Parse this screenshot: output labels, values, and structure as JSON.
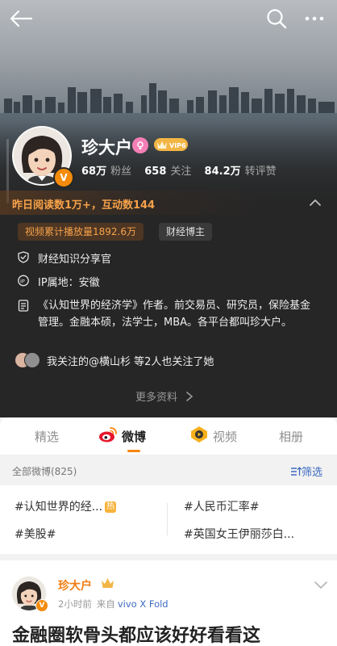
{
  "topbar": {
    "back_icon": "back-arrow-icon",
    "search_icon": "search-icon",
    "more_icon": "more-dots-icon"
  },
  "profile": {
    "name": "珍大户",
    "verified_badge": "V",
    "vip_label": "VIP6",
    "stats": [
      {
        "value": "68万",
        "label": "粉丝"
      },
      {
        "value": "658",
        "label": "关注"
      },
      {
        "value": "84.2万",
        "label": "转评赞"
      }
    ],
    "read_stats": "昨日阅读数1万+，互动数144",
    "tags": [
      "视频累计播放量1892.6万",
      "财经博主"
    ],
    "certification": "财经知识分享官",
    "ip_location": "IP属地：安徽",
    "bio": "《认知世界的经济学》作者。前交易员、研究员，保险基金管理。金融本硕，法学士，MBA。各平台都叫珍大户。",
    "mutual": "我关注的@横山杉 等2人也关注了她",
    "more_info": "更多资料"
  },
  "tabs": [
    {
      "label": "精选"
    },
    {
      "label": "微博"
    },
    {
      "label": "视频"
    },
    {
      "label": "相册"
    }
  ],
  "filter": {
    "left": "全部微博(825)",
    "right": "筛选"
  },
  "topics": [
    "#认知世界的经...",
    "#人民币汇率#",
    "#美股#",
    "#英国女王伊丽莎白..."
  ],
  "hot_badge": "热",
  "post": {
    "author": "珍大户",
    "time": "2小时前",
    "source_label": "来自",
    "device": "vivo X Fold",
    "text": "金融圈软骨头都应该好好看看这"
  },
  "colors": {
    "accent_orange": "#f5850f",
    "link_blue": "#3c6ac0",
    "header_bg": "#262626"
  }
}
